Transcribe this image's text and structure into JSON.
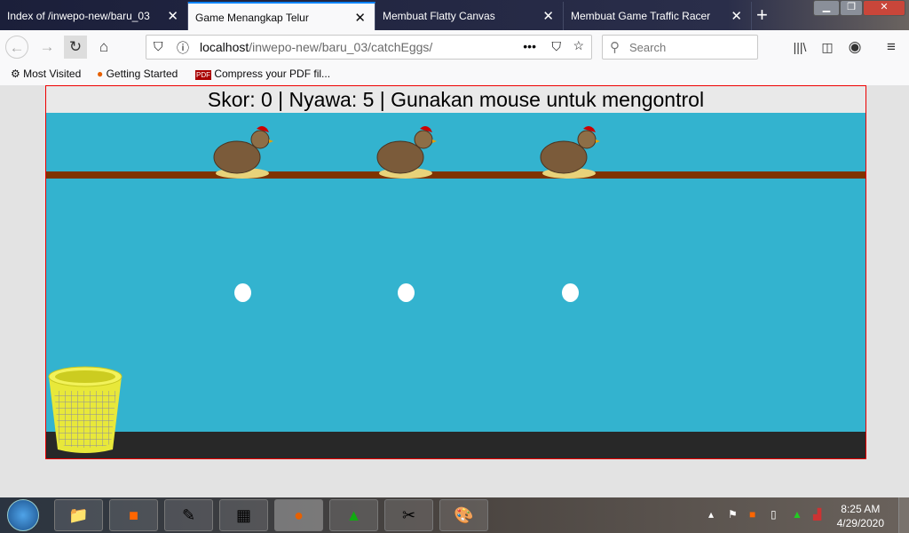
{
  "tabs": [
    {
      "label": "Index of /inwepo-new/baru_03"
    },
    {
      "label": "Game Menangkap Telur",
      "active": true
    },
    {
      "label": "Membuat Flatty Canvas"
    },
    {
      "label": "Membuat Game Traffic Racer"
    }
  ],
  "url": {
    "host": "localhost",
    "path": "/inwepo-new/baru_03/catchEggs/"
  },
  "search": {
    "placeholder": "Search"
  },
  "bookmarks": [
    {
      "label": "Most Visited"
    },
    {
      "label": "Getting Started"
    },
    {
      "label": "Compress your PDF fil..."
    }
  ],
  "game": {
    "hud": "Skor: 0 | Nyawa: 5 | Gunakan mouse untuk mengontrol",
    "score": 0,
    "lives": 5,
    "colors": {
      "sky": "#33b3cf",
      "plank": "#7f3300",
      "ground": "#282828"
    }
  },
  "taskbar": {
    "time": "8:25 AM",
    "date": "4/29/2020",
    "apps": [
      "explorer-icon",
      "xampp-icon",
      "notepad-icon",
      "calculator-icon",
      "firefox-icon",
      "sketchup-icon",
      "snipping-icon",
      "paint-icon"
    ]
  }
}
